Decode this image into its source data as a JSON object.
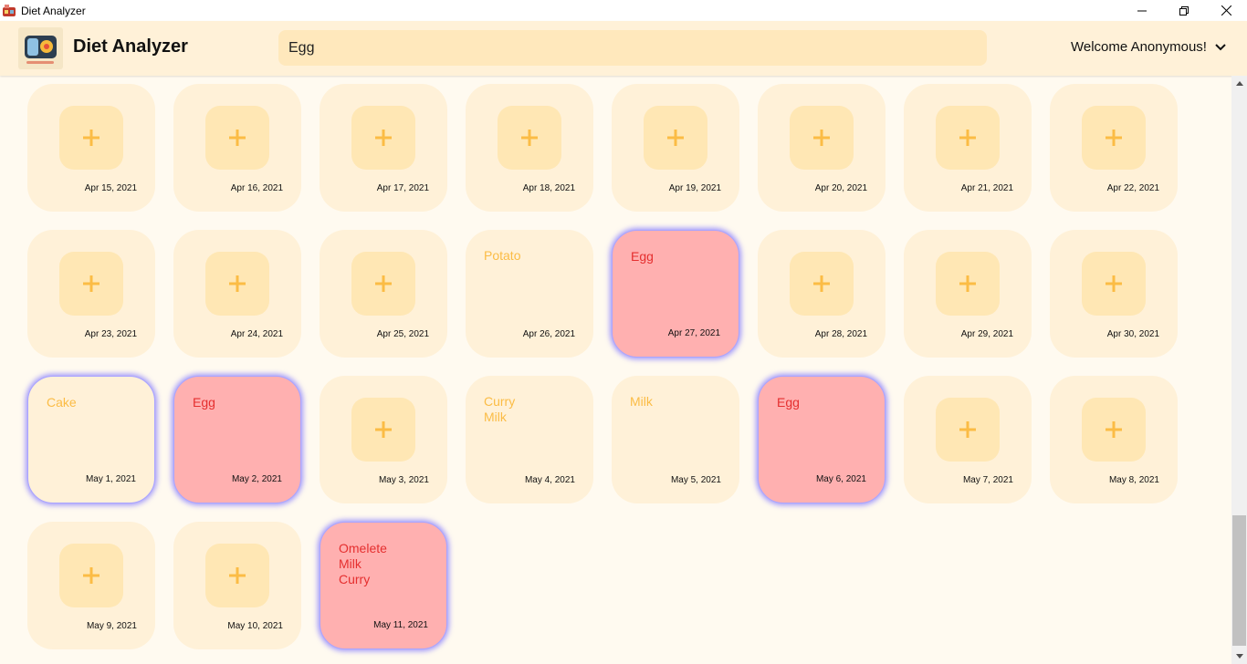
{
  "window": {
    "title": "Diet Analyzer",
    "icon": "app-icon"
  },
  "header": {
    "app_name": "Diet Analyzer",
    "search_value": "Egg",
    "welcome": "Welcome Anonymous!"
  },
  "colors": {
    "card_empty": "#fff1d8",
    "card_alert": "#ffb0b0",
    "plus": "#fbbc45",
    "food_text": "#fbbc45",
    "food_alert_text": "#e52f2f",
    "highlight_glow": "#a9a4ff"
  },
  "days": [
    {
      "date": "Apr 15, 2021",
      "foods": "",
      "alert": false,
      "highlight": false
    },
    {
      "date": "Apr 16, 2021",
      "foods": "",
      "alert": false,
      "highlight": false
    },
    {
      "date": "Apr 17, 2021",
      "foods": "",
      "alert": false,
      "highlight": false
    },
    {
      "date": "Apr 18, 2021",
      "foods": "",
      "alert": false,
      "highlight": false
    },
    {
      "date": "Apr 19, 2021",
      "foods": "",
      "alert": false,
      "highlight": false
    },
    {
      "date": "Apr 20, 2021",
      "foods": "",
      "alert": false,
      "highlight": false
    },
    {
      "date": "Apr 21, 2021",
      "foods": "",
      "alert": false,
      "highlight": false
    },
    {
      "date": "Apr 22, 2021",
      "foods": "",
      "alert": false,
      "highlight": false
    },
    {
      "date": "Apr 23, 2021",
      "foods": "",
      "alert": false,
      "highlight": false
    },
    {
      "date": "Apr 24, 2021",
      "foods": "",
      "alert": false,
      "highlight": false
    },
    {
      "date": "Apr 25, 2021",
      "foods": "",
      "alert": false,
      "highlight": false
    },
    {
      "date": "Apr 26, 2021",
      "foods": "Potato",
      "alert": false,
      "highlight": false
    },
    {
      "date": "Apr 27, 2021",
      "foods": "Egg",
      "alert": true,
      "highlight": true
    },
    {
      "date": "Apr 28, 2021",
      "foods": "",
      "alert": false,
      "highlight": false
    },
    {
      "date": "Apr 29, 2021",
      "foods": "",
      "alert": false,
      "highlight": false
    },
    {
      "date": "Apr 30, 2021",
      "foods": "",
      "alert": false,
      "highlight": false
    },
    {
      "date": "May 1, 2021",
      "foods": "Cake",
      "alert": false,
      "highlight": true
    },
    {
      "date": "May 2, 2021",
      "foods": "Egg",
      "alert": true,
      "highlight": true
    },
    {
      "date": "May 3, 2021",
      "foods": "",
      "alert": false,
      "highlight": false
    },
    {
      "date": "May 4, 2021",
      "foods": "Curry\nMilk",
      "alert": false,
      "highlight": false
    },
    {
      "date": "May 5, 2021",
      "foods": "Milk",
      "alert": false,
      "highlight": false
    },
    {
      "date": "May 6, 2021",
      "foods": "Egg",
      "alert": true,
      "highlight": true
    },
    {
      "date": "May 7, 2021",
      "foods": "",
      "alert": false,
      "highlight": false
    },
    {
      "date": "May 8, 2021",
      "foods": "",
      "alert": false,
      "highlight": false
    },
    {
      "date": "May 9, 2021",
      "foods": "",
      "alert": false,
      "highlight": false
    },
    {
      "date": "May 10, 2021",
      "foods": "",
      "alert": false,
      "highlight": false
    },
    {
      "date": "May 11, 2021",
      "foods": "Omelete\nMilk\nCurry",
      "alert": true,
      "highlight": true
    }
  ]
}
